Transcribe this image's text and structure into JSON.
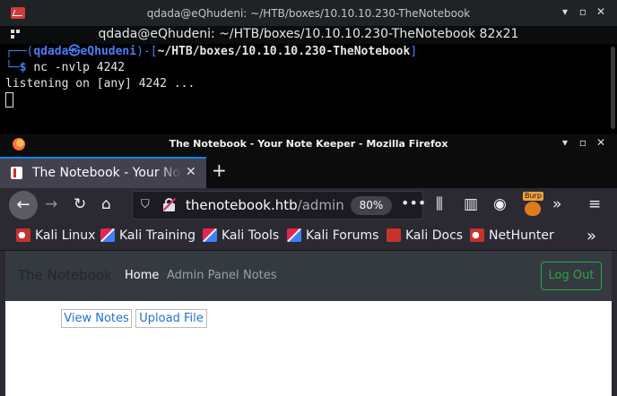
{
  "terminal": {
    "window_title": "qdada@eQhudeni: ~/HTB/boxes/10.10.10.230-TheNotebook",
    "tab_title": "qdada@eQhudeni: ~/HTB/boxes/10.10.10.230-TheNotebook 82x21",
    "prompt_user": "qdada",
    "prompt_host": "eQhudeni",
    "prompt_path": "~/HTB/boxes/10.10.10.230-TheNotebook",
    "command": "nc -nvlp 4242",
    "output": "listening on [any] 4242 ..."
  },
  "firefox": {
    "window_title": "The Notebook - Your Note Keeper - Mozilla Firefox",
    "tab_label": "The Notebook - Your Note Keeper",
    "url_host": "thenotebook.htb",
    "url_path": "/admin",
    "zoom": "80%",
    "extension_badge": "Burp",
    "bookmarks": [
      "Kali Linux",
      "Kali Training",
      "Kali Tools",
      "Kali Forums",
      "Kali Docs",
      "NetHunter"
    ]
  },
  "page": {
    "brand": "The Notebook",
    "nav": [
      "Home",
      "Admin Panel",
      "Notes"
    ],
    "logout": "Log Out",
    "buttons": [
      "View Notes",
      "Upload File"
    ]
  },
  "colors": {
    "accent_tab": "#0a84ff",
    "logout_green": "#28a745",
    "prompt_blue": "#3b82f6",
    "link_blue": "#1d6fd8"
  }
}
